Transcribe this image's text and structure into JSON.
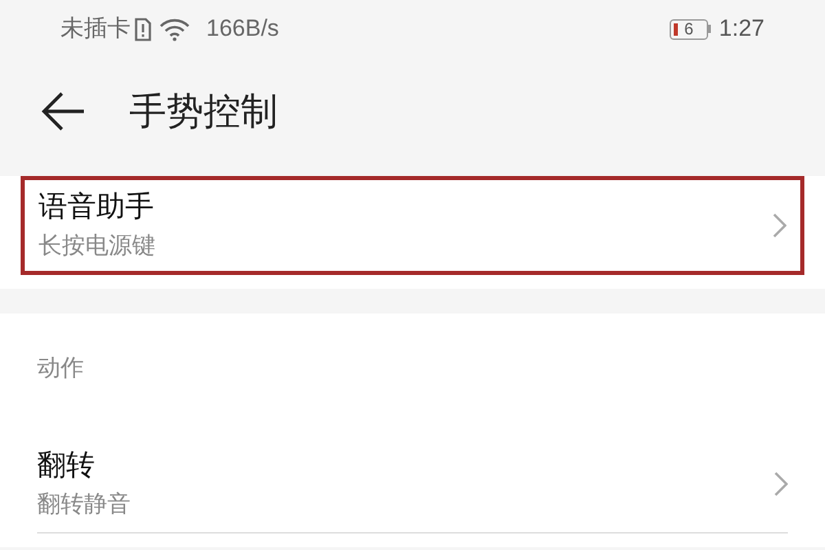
{
  "status_bar": {
    "carrier": "未插卡",
    "speed": "166B/s",
    "battery": "6",
    "time": "1:27"
  },
  "header": {
    "title": "手势控制"
  },
  "sections": [
    {
      "items": [
        {
          "title": "语音助手",
          "subtitle": "长按电源键",
          "highlighted": true
        }
      ]
    },
    {
      "heading": "动作",
      "items": [
        {
          "title": "翻转",
          "subtitle": "翻转静音",
          "highlighted": false
        }
      ]
    }
  ]
}
